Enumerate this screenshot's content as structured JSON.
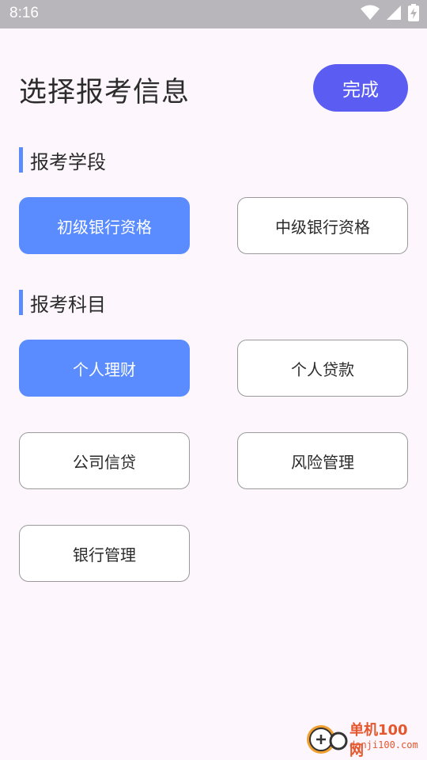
{
  "status_bar": {
    "time": "8:16",
    "icons": [
      "wifi-icon",
      "signal-icon",
      "battery-charging-icon"
    ]
  },
  "header": {
    "title": "选择报考信息",
    "done_label": "完成"
  },
  "colors": {
    "accent_blue": "#5b8cff",
    "done_button": "#5b5cf2",
    "background": "#fdf7fd"
  },
  "sections": [
    {
      "title": "报考学段",
      "options": [
        {
          "label": "初级银行资格",
          "selected": true
        },
        {
          "label": "中级银行资格",
          "selected": false
        }
      ]
    },
    {
      "title": "报考科目",
      "options": [
        {
          "label": "个人理财",
          "selected": true
        },
        {
          "label": "个人贷款",
          "selected": false
        },
        {
          "label": "公司信贷",
          "selected": false
        },
        {
          "label": "风险管理",
          "selected": false
        },
        {
          "label": "银行管理",
          "selected": false
        }
      ]
    }
  ],
  "watermark": {
    "text": "单机100网",
    "subtext": "danji100.com"
  }
}
